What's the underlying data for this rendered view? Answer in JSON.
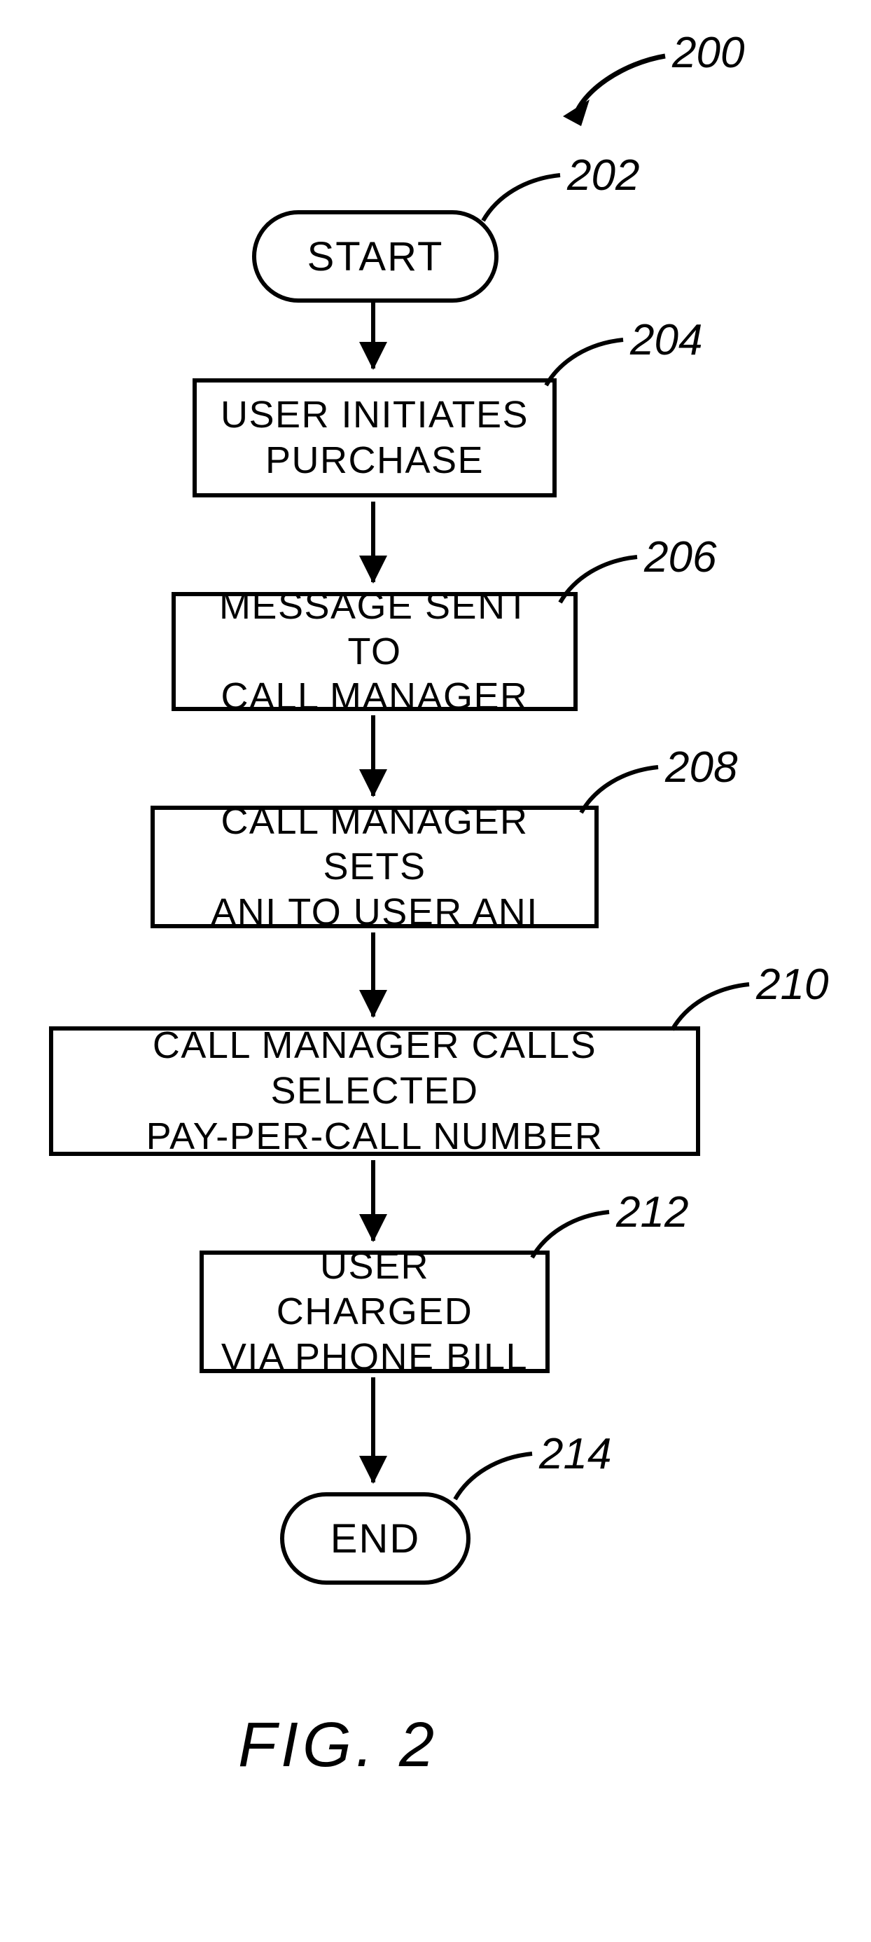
{
  "diagram": {
    "page_ref": "200",
    "steps": {
      "start": {
        "ref": "202",
        "text": "START"
      },
      "s1": {
        "ref": "204",
        "text": "USER INITIATES\nPURCHASE"
      },
      "s2": {
        "ref": "206",
        "text": "MESSAGE SENT TO\nCALL MANAGER"
      },
      "s3": {
        "ref": "208",
        "text": "CALL MANAGER SETS\nANI TO USER ANI"
      },
      "s4": {
        "ref": "210",
        "text": "CALL MANAGER CALLS SELECTED\nPAY-PER-CALL NUMBER"
      },
      "s5": {
        "ref": "212",
        "text": "USER CHARGED\nVIA PHONE BILL"
      },
      "end": {
        "ref": "214",
        "text": "END"
      }
    },
    "figure_caption": "FIG.  2"
  }
}
